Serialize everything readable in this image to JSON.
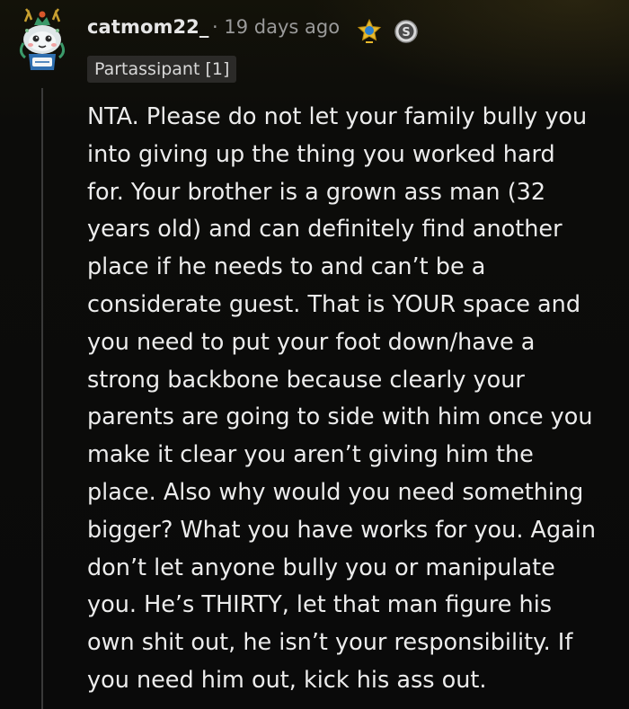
{
  "comment": {
    "username": "catmom22_",
    "separator_time": "· 19 days ago",
    "flair": "Partassipant [1]",
    "lines": [
      "NTA. Please do not let your family bully you",
      "into giving up the thing you worked hard",
      "for. Your brother is a grown ass man (32",
      "years old) and can definitely find another",
      "place if he needs to and can’t be a",
      "considerate guest. That is YOUR space and",
      "you need to put your foot down/have a",
      "strong backbone because clearly your",
      "parents are going to side with him once you",
      "make it clear you aren’t giving him the",
      "place. Also why would you need something",
      "bigger? What you have works for you. Again",
      "don’t let anyone bully you or manipulate",
      "you. He’s THIRTY, let that man figure his",
      "own shit out, he isn’t your responsibility. If",
      "you need him out, kick his ass out."
    ]
  },
  "icons": {
    "avatar": "snoo-avatar-icon",
    "award_1": "award-icon",
    "award_2": "silver-award-icon"
  },
  "colors": {
    "background": "#0a0a0a",
    "text": "#ececec",
    "meta": "#9a9a9a",
    "flair_bg": "#2b2a28"
  }
}
